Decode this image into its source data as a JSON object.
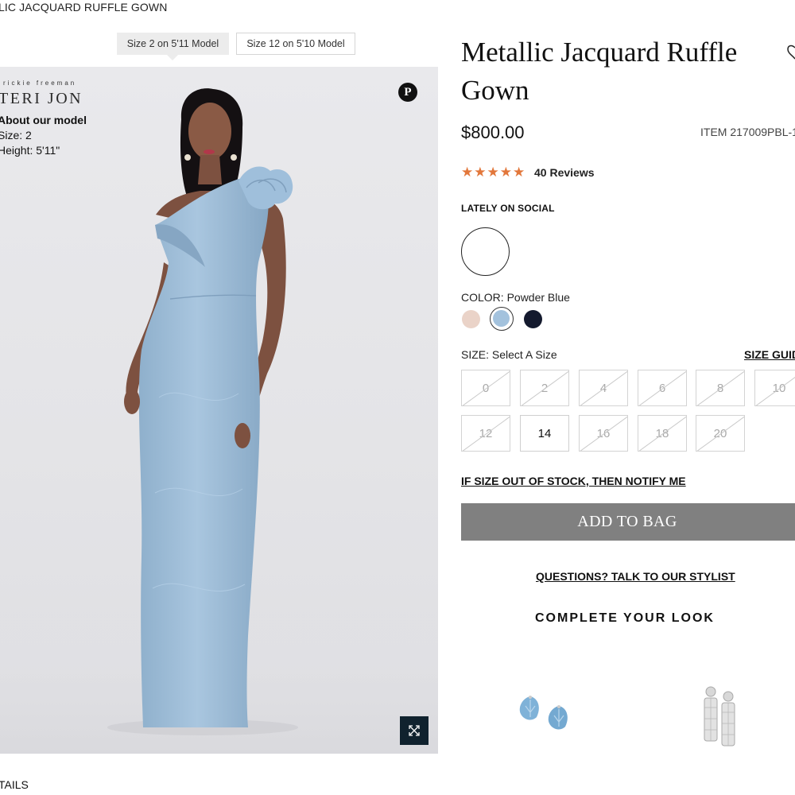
{
  "breadcrumb": "LIC JACQUARD RUFFLE GOWN",
  "model_tabs": [
    {
      "label": "Size 2 on 5'11 Model",
      "active": true
    },
    {
      "label": "Size 12 on 5'10 Model",
      "active": false
    }
  ],
  "gallery": {
    "brand_tagline": "rickie freeman",
    "brand_name": "TERI JON",
    "about_title": "About our model",
    "about_size": "Size: 2",
    "about_height": "Height: 5'11\"",
    "pinterest_icon": "pinterest-icon",
    "expand_icon": "expand-icon",
    "dress_color": "#9cbdd9"
  },
  "product": {
    "title": "Metallic Jacquard Ruffle Gown",
    "price": "$800.00",
    "item_number": "ITEM 217009PBL-1",
    "rating": 5,
    "reviews": "40 Reviews",
    "star_color": "#e2773b",
    "lately_on_social": "LATELY ON SOCIAL",
    "color_label": "COLOR: Powder Blue",
    "swatches": [
      {
        "name": "blush",
        "hex": "#ead3c8",
        "selected": false
      },
      {
        "name": "powder-blue",
        "hex": "#a3c2dd",
        "selected": true
      },
      {
        "name": "navy",
        "hex": "#141a2e",
        "selected": false
      }
    ],
    "size_label": "SIZE: Select A Size",
    "size_guide": "SIZE GUIDE",
    "sizes": [
      {
        "label": "0",
        "available": false
      },
      {
        "label": "2",
        "available": false
      },
      {
        "label": "4",
        "available": false
      },
      {
        "label": "6",
        "available": false
      },
      {
        "label": "8",
        "available": false
      },
      {
        "label": "10",
        "available": false
      },
      {
        "label": "12",
        "available": false
      },
      {
        "label": "14",
        "available": true
      },
      {
        "label": "16",
        "available": false
      },
      {
        "label": "18",
        "available": false
      },
      {
        "label": "20",
        "available": false
      }
    ],
    "notify_link": "IF SIZE OUT OF STOCK, THEN NOTIFY ME",
    "add_to_bag": "ADD TO BAG",
    "stylist_link": "QUESTIONS? TALK TO OUR STYLIST",
    "complete_look": "COMPLETE YOUR LOOK"
  },
  "details_tab": "TAILS"
}
